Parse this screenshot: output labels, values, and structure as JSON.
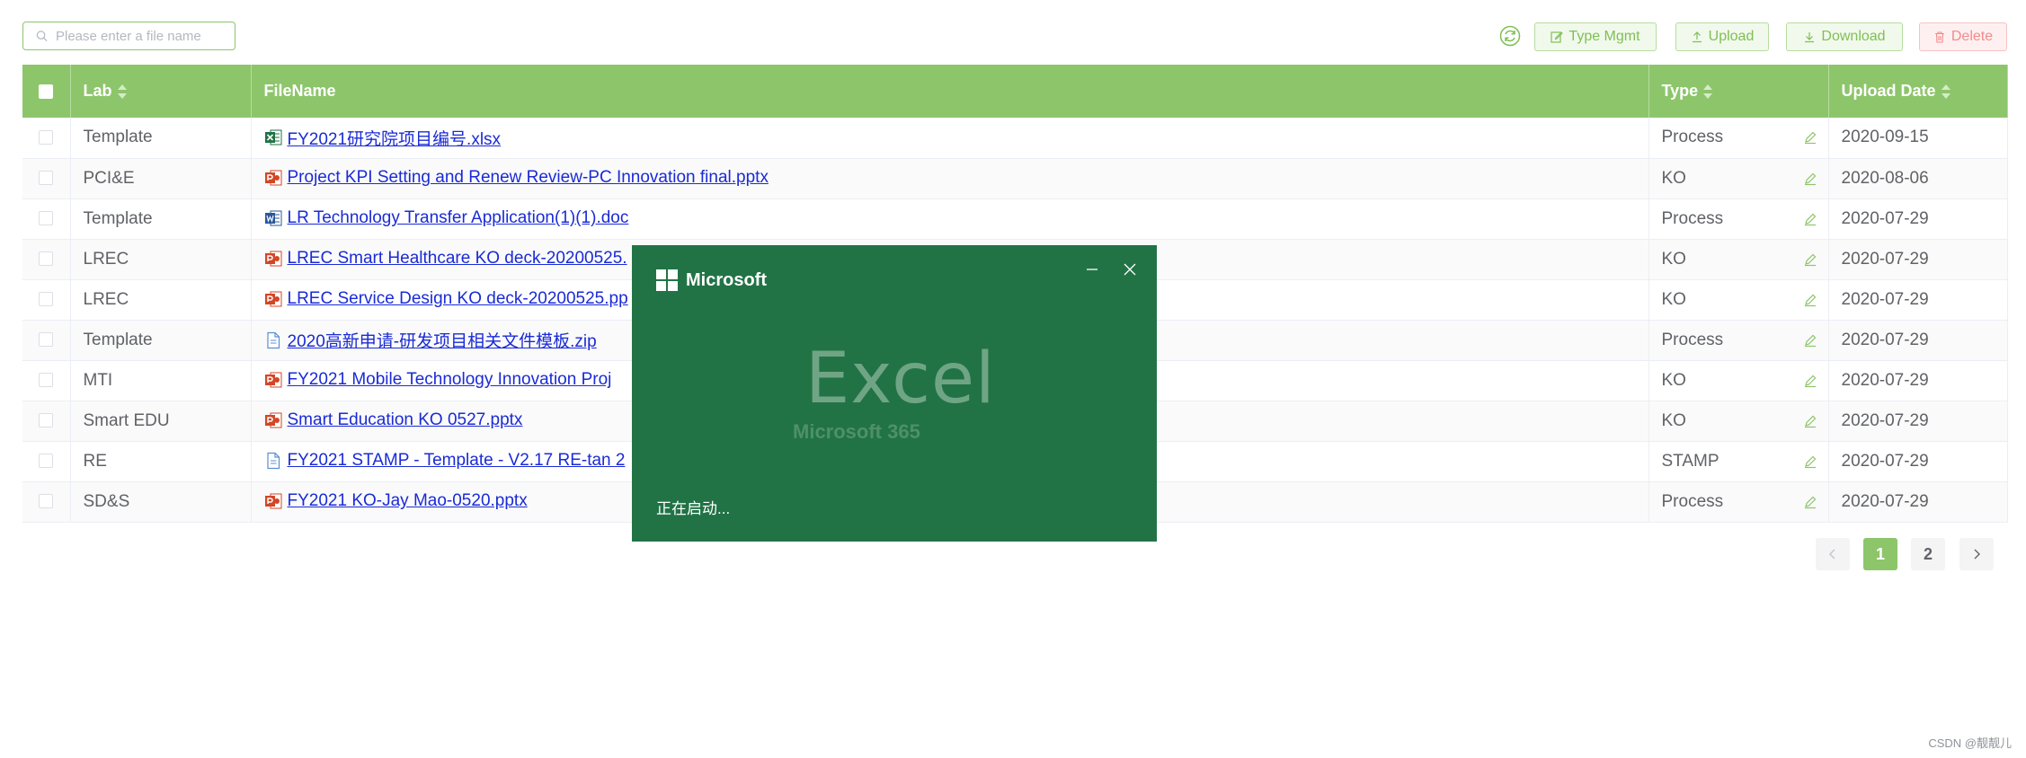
{
  "toolbar": {
    "search_placeholder": "Please enter a file name",
    "type_mgmt_label": "Type Mgmt",
    "upload_label": "Upload",
    "download_label": "Download",
    "delete_label": "Delete"
  },
  "table": {
    "headers": {
      "lab": "Lab",
      "filename": "FileName",
      "type": "Type",
      "upload_date": "Upload Date"
    },
    "rows": [
      {
        "lab": "Template",
        "filename": "FY2021研究院项目编号.xlsx",
        "icon": "excel-file-icon",
        "type": "Process",
        "date": "2020-09-15"
      },
      {
        "lab": "PCI&E",
        "filename": "Project KPI Setting and Renew Review-PC Innovation final.pptx",
        "icon": "powerpoint-file-icon",
        "type": "KO",
        "date": "2020-08-06"
      },
      {
        "lab": "Template",
        "filename": "LR Technology Transfer Application(1)(1).doc",
        "icon": "word-file-icon",
        "type": "Process",
        "date": "2020-07-29"
      },
      {
        "lab": "LREC",
        "filename": "LREC Smart Healthcare KO deck-20200525.",
        "icon": "powerpoint-file-icon",
        "type": "KO",
        "date": "2020-07-29"
      },
      {
        "lab": "LREC",
        "filename": "LREC Service Design KO deck-20200525.pp",
        "icon": "powerpoint-file-icon",
        "type": "KO",
        "date": "2020-07-29"
      },
      {
        "lab": "Template",
        "filename": "2020高新申请-研发项目相关文件模板.zip",
        "icon": "generic-file-icon",
        "type": "Process",
        "date": "2020-07-29"
      },
      {
        "lab": "MTI",
        "filename": "FY2021 Mobile Technology Innovation Proj",
        "icon": "powerpoint-file-icon",
        "type": "KO",
        "date": "2020-07-29"
      },
      {
        "lab": "Smart EDU",
        "filename": "Smart Education KO 0527.pptx",
        "icon": "powerpoint-file-icon",
        "type": "KO",
        "date": "2020-07-29"
      },
      {
        "lab": "RE",
        "filename": "FY2021 STAMP - Template - V2.17 RE-tan 2",
        "icon": "generic-file-icon",
        "type": "STAMP",
        "date": "2020-07-29"
      },
      {
        "lab": "SD&S",
        "filename": "FY2021 KO-Jay Mao-0520.pptx",
        "icon": "powerpoint-file-icon",
        "type": "Process",
        "date": "2020-07-29"
      }
    ]
  },
  "pagination": {
    "pages": [
      "1",
      "2"
    ],
    "current": "1"
  },
  "splash": {
    "brand": "Microsoft",
    "app_name": "Excel",
    "suite": "Microsoft 365",
    "status": "正在启动..."
  },
  "watermark": "CSDN @靓靓儿",
  "colors": {
    "primary": "#8dc56b",
    "link": "#1a2bd6",
    "excel_green": "#217346",
    "danger": "#f28b8b"
  }
}
